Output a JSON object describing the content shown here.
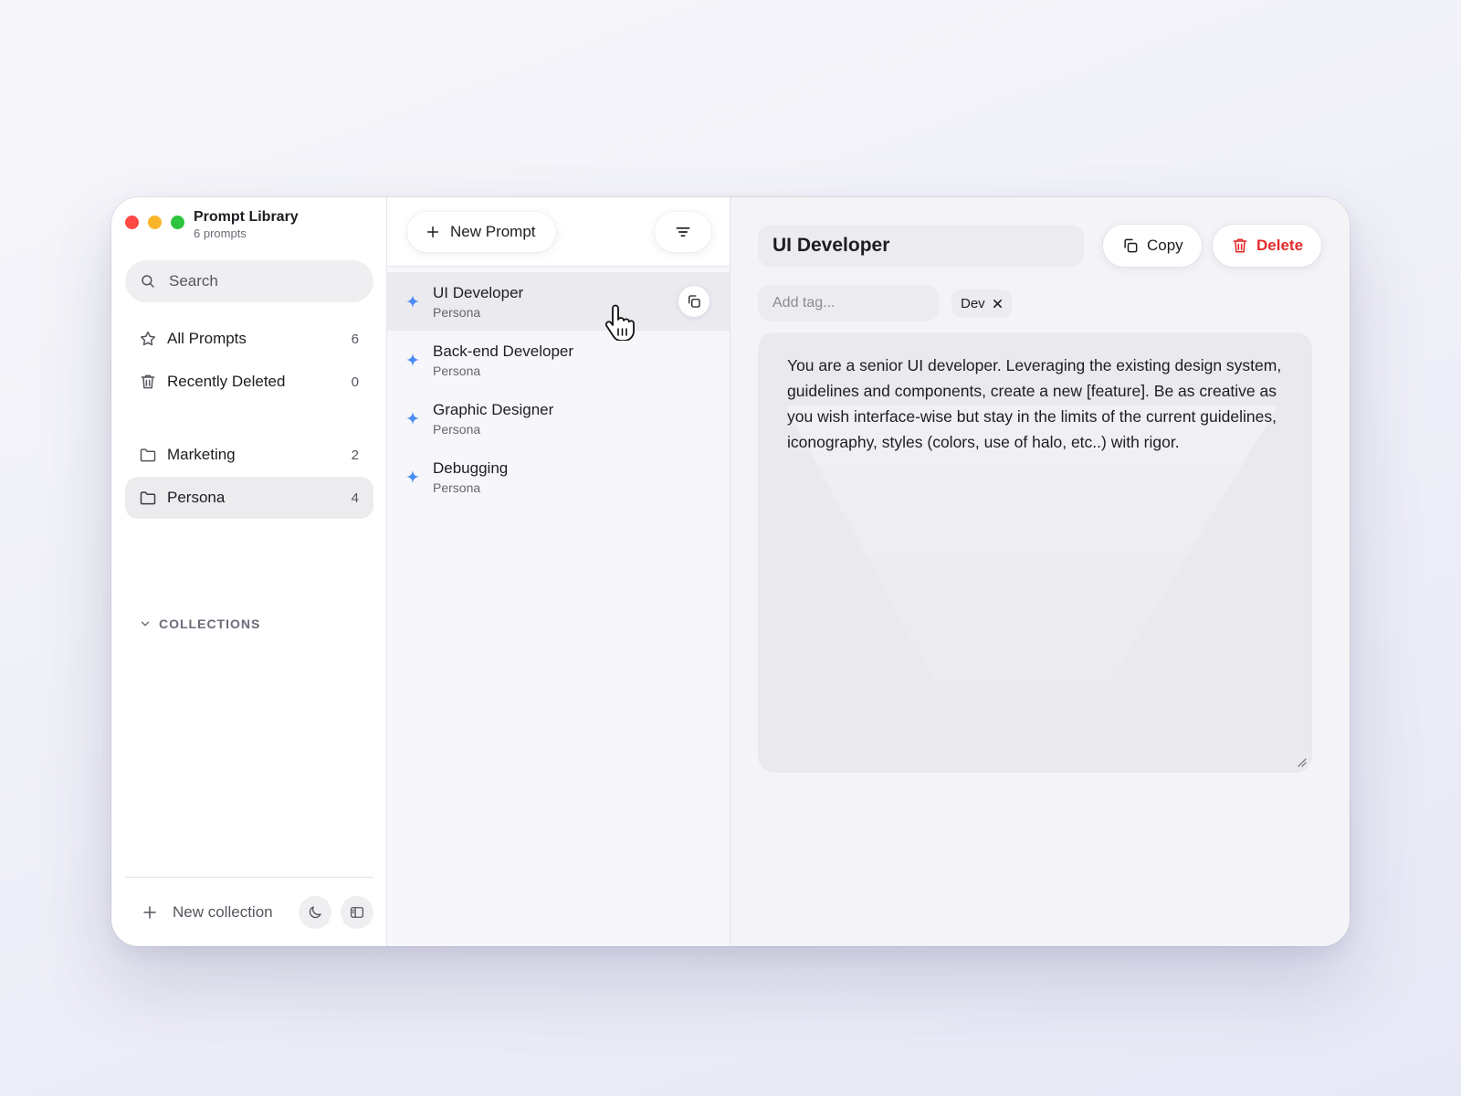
{
  "app": {
    "title": "Prompt Library",
    "subtitle": "6 prompts"
  },
  "sidebar": {
    "search_placeholder": "Search",
    "nav": [
      {
        "label": "All Prompts",
        "count": "6",
        "icon": "star-icon"
      },
      {
        "label": "Recently Deleted",
        "count": "0",
        "icon": "trash-icon"
      }
    ],
    "collections_header": "COLLECTIONS",
    "collections": [
      {
        "label": "Marketing",
        "count": "2",
        "icon": "folder-icon"
      },
      {
        "label": "Persona",
        "count": "4",
        "icon": "folder-icon",
        "active": true
      }
    ],
    "footer": {
      "new_collection_label": "New collection",
      "icons": [
        "moon-icon",
        "sidebar-toggle-icon"
      ]
    }
  },
  "list": {
    "new_prompt_label": "New Prompt",
    "filter_icon": "filter-icon",
    "items": [
      {
        "title": "UI Developer",
        "collection": "Persona",
        "active": true
      },
      {
        "title": "Back-end Developer",
        "collection": "Persona"
      },
      {
        "title": "Graphic Designer",
        "collection": "Persona"
      },
      {
        "title": "Debugging",
        "collection": "Persona"
      }
    ]
  },
  "editor": {
    "title_value": "UI Developer",
    "copy_label": "Copy",
    "delete_label": "Delete",
    "tag_placeholder": "Add tag...",
    "tags": [
      "Dev"
    ],
    "body": "You are a senior UI developer. Leveraging the existing design system, guidelines and components, create a new [feature]. Be as creative as you wish interface-wise but stay in the limits of the current guidelines, iconography, styles (colors, use of halo, etc..) with rigor."
  },
  "colors": {
    "accent_blue": "#4a8cf7",
    "danger": "#e62b2b",
    "selected_bg": "#ececee"
  }
}
